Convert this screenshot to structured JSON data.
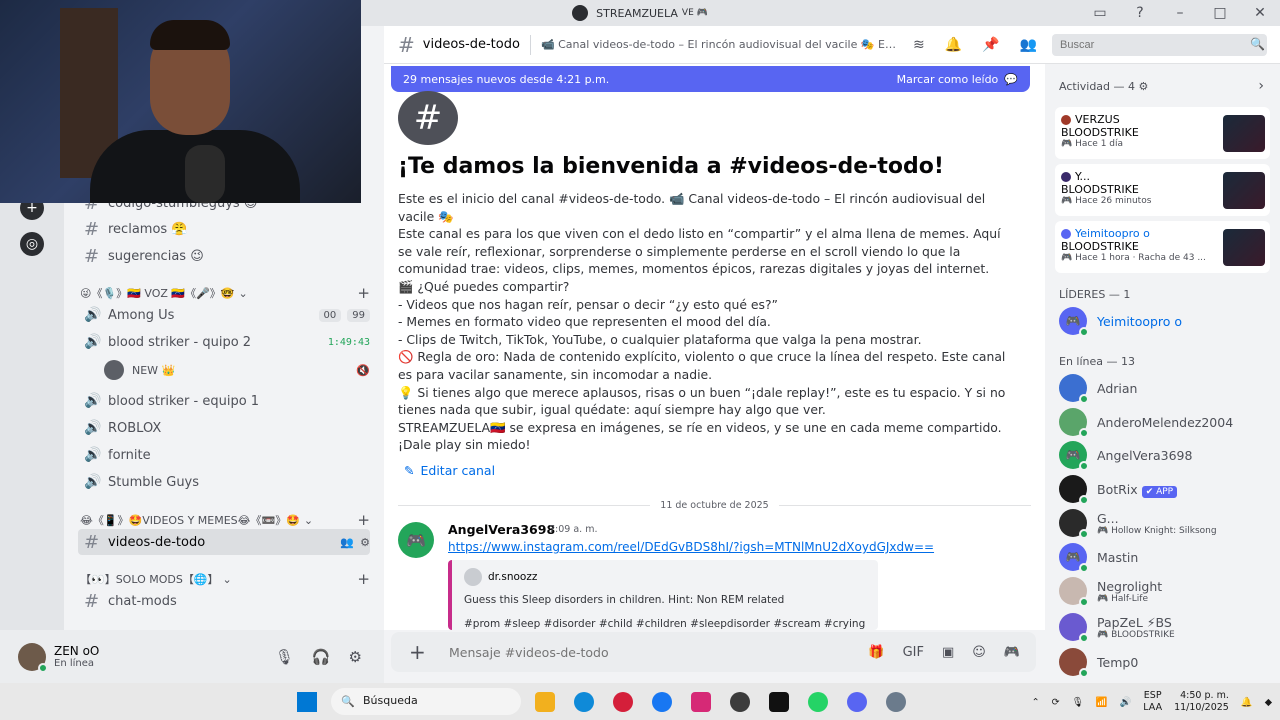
{
  "window": {
    "title": "STREAMZUELA",
    "title_suffix": "VE 🎮"
  },
  "sidebar": {
    "channels_top": [
      {
        "label": "código-stumbleguys 😊"
      },
      {
        "label": "reclamos 😤"
      },
      {
        "label": "sugerencias 😉"
      }
    ],
    "voice_category": "😜《🎙️》🇻🇪 VOZ 🇻🇪《🎤》🤓",
    "voice_channels": [
      {
        "label": "Among Us",
        "count_a": "00",
        "count_b": "99"
      },
      {
        "label": "blood striker - quipo 2",
        "timer": "1:49:43"
      }
    ],
    "voice_user": {
      "name": "NEW 👑"
    },
    "voice_channels_more": [
      {
        "label": "blood striker - equipo 1"
      },
      {
        "label": "ROBLOX"
      },
      {
        "label": "fornite"
      },
      {
        "label": "Stumble Guys"
      }
    ],
    "videos_category": "😂《📱》🤩VIDEOS Y MEMES😂《📼》🤩",
    "active_channel": "videos-de-todo",
    "mods_category": "【👀】SOLO MODS【🌐】",
    "mods_channel": "chat-mods"
  },
  "user": {
    "name": "ZEN oO",
    "status": "En línea"
  },
  "header": {
    "channel": "videos-de-todo",
    "topic": "📹 Canal videos-de-todo – El rincón audiovisual del vacile 🎭 Est...",
    "search_placeholder": "Buscar"
  },
  "newbar": {
    "text": "29 mensajes nuevos desde 4:21 p.m.",
    "mark": "Marcar como leído"
  },
  "welcome": {
    "title": "¡Te damos la bienvenida a #videos-de-todo!",
    "lines": [
      "Este es el inicio del canal #videos-de-todo. 📹 Canal videos-de-todo – El rincón audiovisual del vacile 🎭",
      "Este canal es para los que viven con el dedo listo en “compartir” y el alma llena de memes. Aquí se vale reír, reflexionar, sorprenderse o simplemente perderse en el scroll viendo lo que la comunidad trae: videos, clips, memes, momentos épicos, rarezas digitales y joyas del internet.",
      "🎬 ¿Qué puedes compartir?",
      "- Videos que nos hagan reír, pensar o decir “¿y esto qué es?”",
      "- Memes en formato video que representen el mood del día.",
      "- Clips de Twitch, TikTok, YouTube, o cualquier plataforma que valga la pena mostrar.",
      "🚫 Regla de oro: Nada de contenido explícito, violento o que cruce la línea del respeto. Este canal es para vacilar sanamente, sin incomodar a nadie.",
      "💡 Si tienes algo que merece aplausos, risas o un buen “¡dale replay!”, este es tu espacio. Y si no tienes nada que subir, igual quédate: aquí siempre hay algo que ver.",
      "STREAMZUELA🇻🇪 se expresa en imágenes, se ríe en videos, y se une en cada meme compartido.",
      "¡Dale play sin miedo!"
    ],
    "edit": "Editar canal"
  },
  "date_divider": "11 de octubre de 2025",
  "message": {
    "author": "AngelVera3698",
    "time": "7:09 a. m.",
    "link": "https://www.instagram.com/reel/DEdGvBDS8hI/?igsh=MTNlMnU2dXoydGJxdw==",
    "embed": {
      "author": "dr.snoozz",
      "text": "Guess this Sleep disorders in children. Hint: Non REM related",
      "tags": "#prom #sleep #disorder #child #children #sleepdisorder #scream #crying"
    }
  },
  "composer": {
    "placeholder": "Mensaje #videos-de-todo"
  },
  "activity": {
    "header": "Actividad — 4 ⚙",
    "cards": [
      {
        "user": "VERZUS",
        "game": "BLOODSTRIKE",
        "time": "🎮 Hace 1 día"
      },
      {
        "user": "Y...",
        "game": "BLOODSTRIKE",
        "time": "🎮 Hace 26 minutos"
      },
      {
        "user": "Yeimitoopro o",
        "game": "BLOODSTRIKE",
        "time": "🎮 Hace 1 hora · Racha de 43 ..."
      }
    ]
  },
  "leaders": {
    "header": "LÍDERES — 1",
    "members": [
      {
        "name": "Yeimitoopro o"
      }
    ]
  },
  "online": {
    "header": "En línea — 13",
    "members": [
      {
        "name": "Adrian",
        "sub": ""
      },
      {
        "name": "AnderoMelendez2004",
        "sub": ""
      },
      {
        "name": "AngelVera3698",
        "sub": ""
      },
      {
        "name": "BotRix",
        "sub": "",
        "badge": "✔ APP"
      },
      {
        "name": "G...",
        "sub": "🎮 Hollow Knight: Silksong"
      },
      {
        "name": "Mastin",
        "sub": ""
      },
      {
        "name": "Negrolight",
        "sub": "🎮 Half-Life"
      },
      {
        "name": "PapZeL ⚡BS",
        "sub": "🎮 BLOODSTRIKE"
      },
      {
        "name": "Temp0",
        "sub": ""
      }
    ]
  },
  "taskbar": {
    "search": "Búsqueda",
    "lang_a": "ESP",
    "lang_b": "LAA",
    "time": "4:50 p. m.",
    "date": "11/10/2025"
  },
  "colors": {
    "accent": "#5865f2",
    "online": "#23a55a",
    "link": "#006ce7"
  }
}
